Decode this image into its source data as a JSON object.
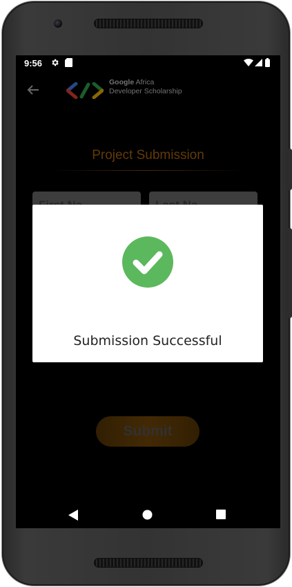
{
  "status_bar": {
    "time": "9:56",
    "icons": [
      "gear-icon",
      "sd-card-icon",
      "wifi-icon",
      "signal-icon",
      "battery-icon"
    ]
  },
  "app": {
    "logo_text_line1_brand": "Google",
    "logo_text_line1_rest": " Africa",
    "logo_text_line2": "Developer Scholarship",
    "page_title": "Project Submission",
    "first_name_placeholder": "First Na",
    "last_name_placeholder": "Last Na",
    "submit_label": "Submit"
  },
  "dialog": {
    "message": "Submission Successful",
    "icon": "check-circle-icon"
  },
  "colors": {
    "accent": "#b36a12",
    "success_green": "#5cb85c",
    "dialog_bg": "#ffffff"
  },
  "nav_bar": {
    "icons": [
      "back-triangle-icon",
      "home-circle-icon",
      "recents-square-icon"
    ]
  }
}
